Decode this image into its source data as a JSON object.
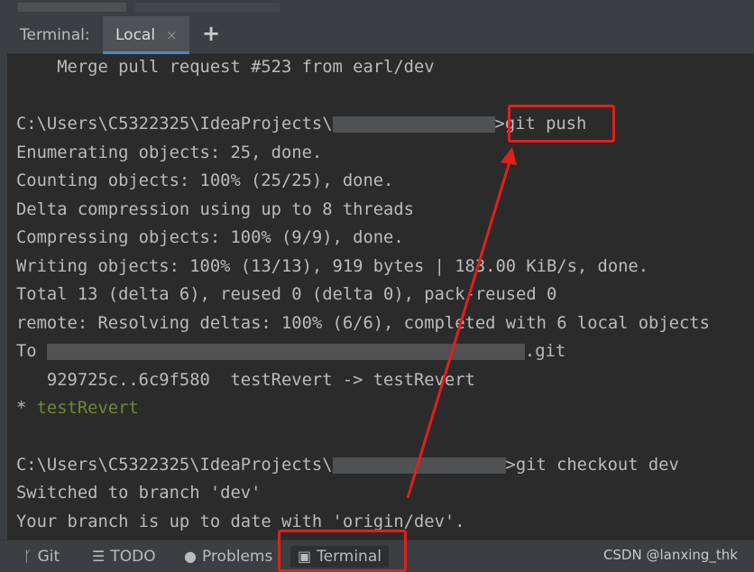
{
  "tabbar": {
    "title": "Terminal:",
    "active_tab": "Local",
    "close_glyph": "×",
    "add_glyph": "+"
  },
  "terminal_lines": [
    "    Merge pull request #523 from earl/dev",
    "",
    "C:\\Users\\C5322325\\IdeaProjects\\",
    "Enumerating objects: 25, done.",
    "Counting objects: 100% (25/25), done.",
    "Delta compression using up to 8 threads",
    "Compressing objects: 100% (9/9), done.",
    "Writing objects: 100% (13/13), 919 bytes | 183.00 KiB/s, done.",
    "Total 13 (delta 6), reused 0 (delta 0), pack-reused 0",
    "remote: Resolving deltas: 100% (6/6), completed with 6 local objects",
    "To ",
    "   929725c..6c9f580  testRevert -> testRevert",
    "* ",
    "",
    "C:\\Users\\C5322325\\IdeaProjects\\",
    "Switched to branch 'dev'",
    "Your branch is up to date with 'origin/dev'."
  ],
  "prompt1_cmd": ">git push",
  "prompt2_cmd": ">git checkout dev",
  "to_suffix": ".git",
  "branch_name": "testRevert",
  "bottom": {
    "git": "Git",
    "todo": "TODO",
    "problems": "Problems",
    "terminal": "Terminal"
  },
  "watermark": "CSDN @lanxing_thk",
  "colors": {
    "annotation": "#e0201a",
    "branch_green": "#6a8a35",
    "active_tab": "#4a88c7"
  }
}
